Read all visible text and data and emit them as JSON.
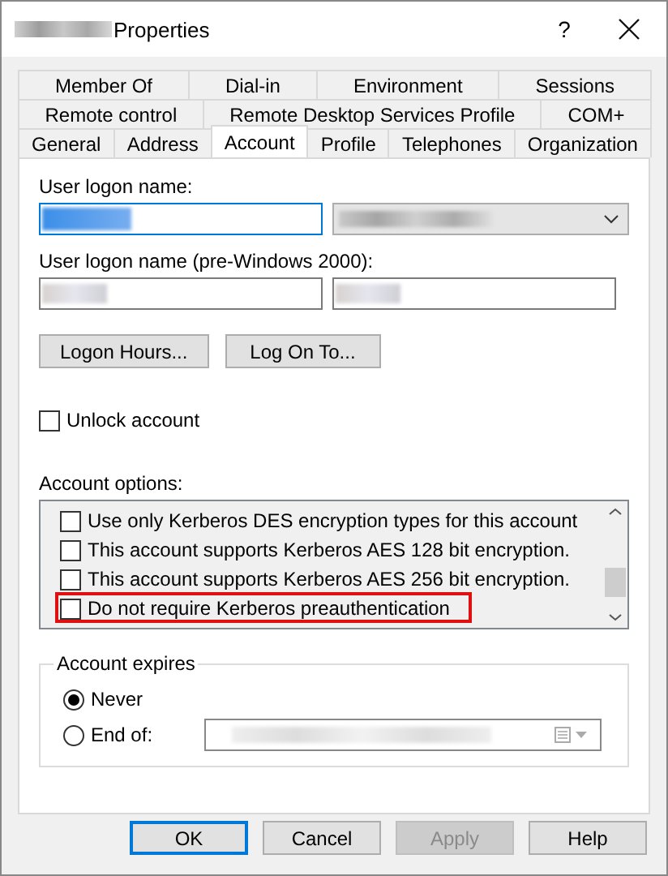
{
  "window": {
    "title": "Properties",
    "help": "?"
  },
  "tab_rows": [
    [
      {
        "label": "Member Of",
        "selected": false
      },
      {
        "label": "Dial-in",
        "selected": false
      },
      {
        "label": "Environment",
        "selected": false
      },
      {
        "label": "Sessions",
        "selected": false
      }
    ],
    [
      {
        "label": "Remote control",
        "selected": false
      },
      {
        "label": "Remote Desktop Services Profile",
        "selected": false
      },
      {
        "label": "COM+",
        "selected": false
      }
    ],
    [
      {
        "label": "General",
        "selected": false
      },
      {
        "label": "Address",
        "selected": false
      },
      {
        "label": "Account",
        "selected": true
      },
      {
        "label": "Profile",
        "selected": false
      },
      {
        "label": "Telephones",
        "selected": false
      },
      {
        "label": "Organization",
        "selected": false
      }
    ]
  ],
  "logon_name": {
    "label": "User logon name:"
  },
  "logon_name_pre2000": {
    "label": "User logon name (pre-Windows 2000):"
  },
  "action_buttons": [
    "Logon Hours...",
    "Log On To..."
  ],
  "unlock": {
    "label": "Unlock account",
    "checked": false
  },
  "account_options": {
    "label": "Account options:",
    "items": [
      {
        "label": "Use only Kerberos DES encryption types for this account",
        "checked": false,
        "highlighted": false
      },
      {
        "label": "This account supports Kerberos AES 128 bit encryption.",
        "checked": false,
        "highlighted": false
      },
      {
        "label": "This account supports Kerberos AES 256 bit encryption.",
        "checked": false,
        "highlighted": false
      },
      {
        "label": "Do not require Kerberos preauthentication",
        "checked": false,
        "highlighted": true
      }
    ]
  },
  "account_expires": {
    "label": "Account expires",
    "options": [
      {
        "label": "Never",
        "selected": true
      },
      {
        "label": "End of:",
        "selected": false
      }
    ]
  },
  "buttons": [
    {
      "label": "OK",
      "default": true,
      "disabled": false
    },
    {
      "label": "Cancel",
      "default": false,
      "disabled": false
    },
    {
      "label": "Apply",
      "default": false,
      "disabled": true
    },
    {
      "label": "Help",
      "default": false,
      "disabled": false
    }
  ]
}
